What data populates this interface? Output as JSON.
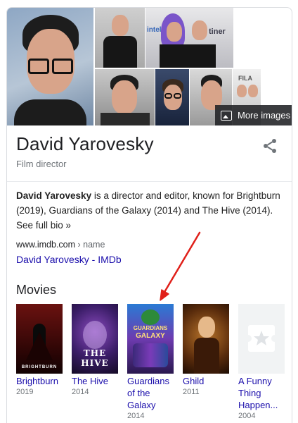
{
  "collage": {
    "more_images_label": "More images",
    "sponsor_text_1": "intel",
    "sponsor_text_2": "tiner",
    "sponsor_text_3": "FILA"
  },
  "entity": {
    "name": "David Yarovesky",
    "subtitle": "Film director"
  },
  "description": {
    "bold_name": "David Yarovesky",
    "text": " is a director and editor, known for Brightburn (2019), Guardians of the Galaxy (2014) and The Hive (2014).",
    "see_more": "See full bio »"
  },
  "source": {
    "domain": "www.imdb.com",
    "path": " › name",
    "link_label": "David Yarovesky - IMDb"
  },
  "movies": {
    "heading": "Movies",
    "items": [
      {
        "title": "Brightburn",
        "year": "2019",
        "poster_text": "BRIGHTBURN"
      },
      {
        "title": "The Hive",
        "year": "2014",
        "poster_text": "THE HIVE"
      },
      {
        "title": "Guardians of the Galaxy",
        "year": "2014",
        "poster_text_top": "GUARDIANS",
        "poster_text_mid": "GALAXY"
      },
      {
        "title": "Ghild",
        "year": "2011"
      },
      {
        "title": "A Funny Thing Happen...",
        "year": "2004"
      }
    ]
  },
  "colors": {
    "link": "#1a0dab",
    "annotation_arrow": "#e0201a",
    "secondary_text": "#70757a"
  }
}
